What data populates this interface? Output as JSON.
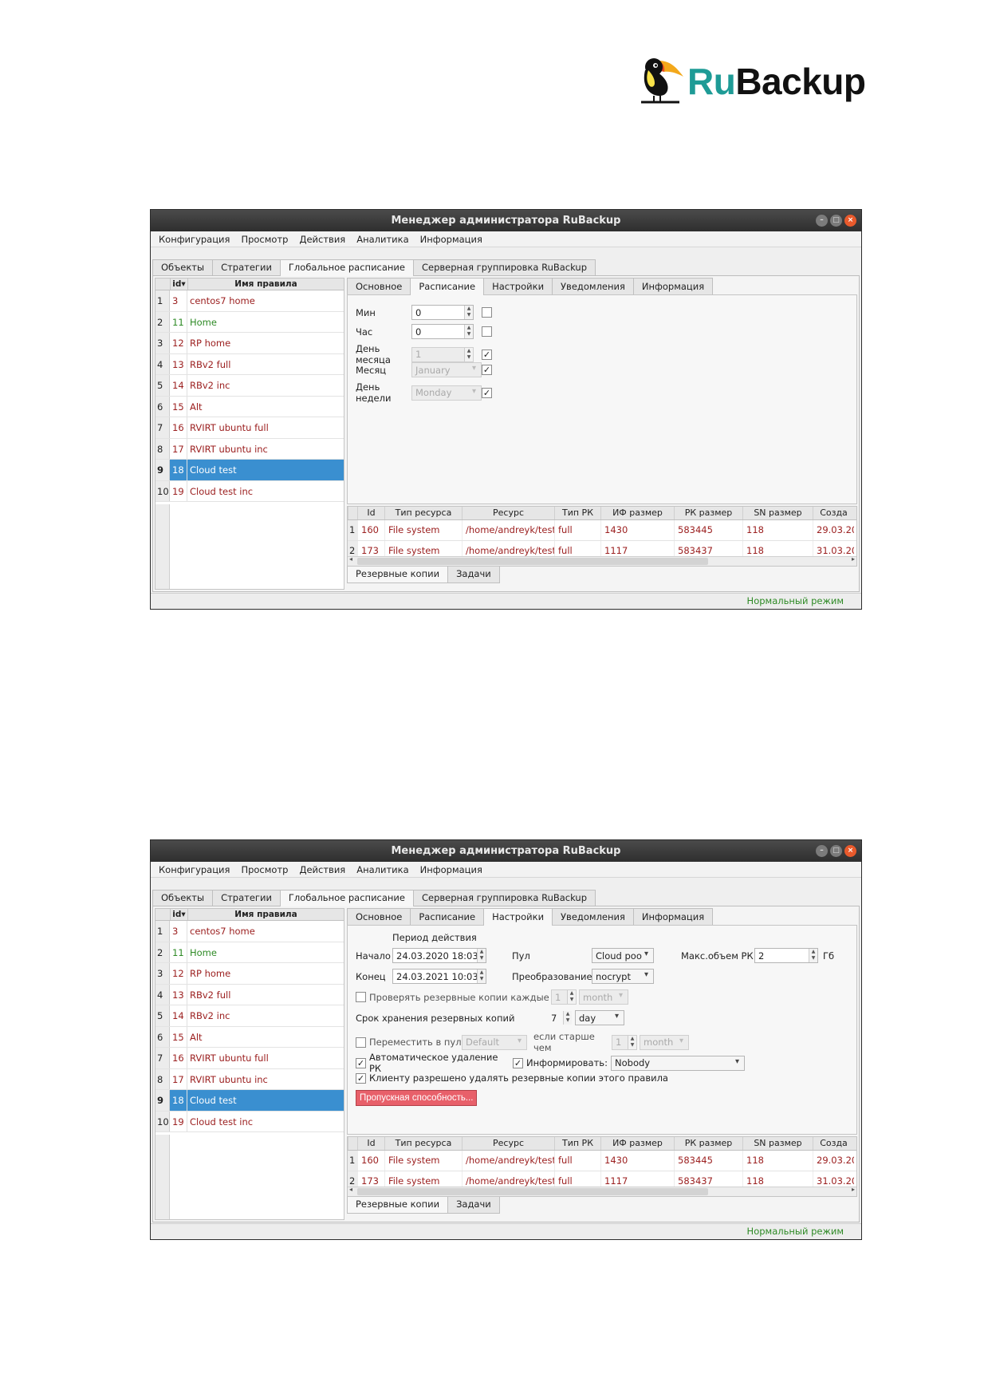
{
  "brand": {
    "ru": "Ru",
    "backup": "Backup",
    "mascot": "toucan-icon"
  },
  "window": {
    "title": "Менеджер администратора RuBackup",
    "btn_min": "–",
    "btn_max": "□",
    "btn_close": "×"
  },
  "menu": [
    "Конфигурация",
    "Просмотр",
    "Действия",
    "Аналитика",
    "Информация"
  ],
  "tabs": [
    "Объекты",
    "Стратегии",
    "Глобальное расписание",
    "Серверная группировка RuBackup"
  ],
  "subtabs": [
    "Основное",
    "Расписание",
    "Настройки",
    "Уведомления",
    "Информация"
  ],
  "rules_head": {
    "id": "id",
    "name": "Имя правила"
  },
  "rules": [
    {
      "n": "1",
      "id": "3",
      "name": "centos7 home",
      "color": "red"
    },
    {
      "n": "2",
      "id": "11",
      "name": "Home",
      "color": "green"
    },
    {
      "n": "3",
      "id": "12",
      "name": "RP home",
      "color": "red"
    },
    {
      "n": "4",
      "id": "13",
      "name": "RBv2 full",
      "color": "red"
    },
    {
      "n": "5",
      "id": "14",
      "name": "RBv2 inc",
      "color": "red"
    },
    {
      "n": "6",
      "id": "15",
      "name": "Alt",
      "color": "red"
    },
    {
      "n": "7",
      "id": "16",
      "name": "RVIRT ubuntu full",
      "color": "red"
    },
    {
      "n": "8",
      "id": "17",
      "name": "RVIRT ubuntu inc",
      "color": "red"
    },
    {
      "n": "9",
      "id": "18",
      "name": "Cloud test",
      "color": "red",
      "selected": true
    },
    {
      "n": "10",
      "id": "19",
      "name": "Cloud test inc",
      "color": "red"
    }
  ],
  "schedule": {
    "min_label": "Мин",
    "min": "0",
    "hour_label": "Час",
    "hour": "0",
    "day_label": "День месяца",
    "day": "1",
    "month_label": "Месяц",
    "month": "January",
    "weekday_label": "День недели",
    "weekday": "Monday",
    "check": "✓"
  },
  "settings": {
    "period_label": "Период действия",
    "start_label": "Начало",
    "start": "24.03.2020 18:03",
    "end_label": "Конец",
    "end": "24.03.2021 10:03",
    "pool_label": "Пул",
    "pool": "Cloud poo",
    "transform_label": "Преобразование",
    "transform": "nocrypt",
    "maxvol_label": "Макс.объем РК",
    "maxvol": "2",
    "maxvol_unit": "Гб",
    "verify_label": "Проверять резервные копии каждые",
    "verify_num": "1",
    "verify_unit": "month",
    "retention_label": "Срок хранения резервных копий",
    "retention_num": "7",
    "retention_unit": "day",
    "move_label": "Переместить в пул",
    "move_pool": "Default",
    "older_label": "если старше чем",
    "older_num": "1",
    "older_unit": "month",
    "autodel_label": "Автоматическое удаление РК",
    "inform_label": "Информировать:",
    "inform": "Nobody",
    "client_del_label": "Клиенту разрешено удалять резервные копии этого правила",
    "bandwidth": "Пропускная способность..."
  },
  "backups": {
    "cols": [
      "Id",
      "Тип ресурса",
      "Ресурс",
      "Тип РК",
      "ИФ размер",
      "РК размер",
      "SN размер",
      "Созда"
    ],
    "rows": [
      {
        "n": "1",
        "id": "160",
        "type": "File system",
        "res": "/home/andreyk/test/",
        "kind": "full",
        "if": "1430",
        "rk": "583445",
        "sn": "118",
        "date": "29.03.202"
      },
      {
        "n": "2",
        "id": "173",
        "type": "File system",
        "res": "/home/andreyk/test/",
        "kind": "full",
        "if": "1117",
        "rk": "583437",
        "sn": "118",
        "date": "31.03.202"
      }
    ]
  },
  "bottom_tabs": [
    "Резервные копии",
    "Задачи"
  ],
  "status": "Нормальный режим"
}
